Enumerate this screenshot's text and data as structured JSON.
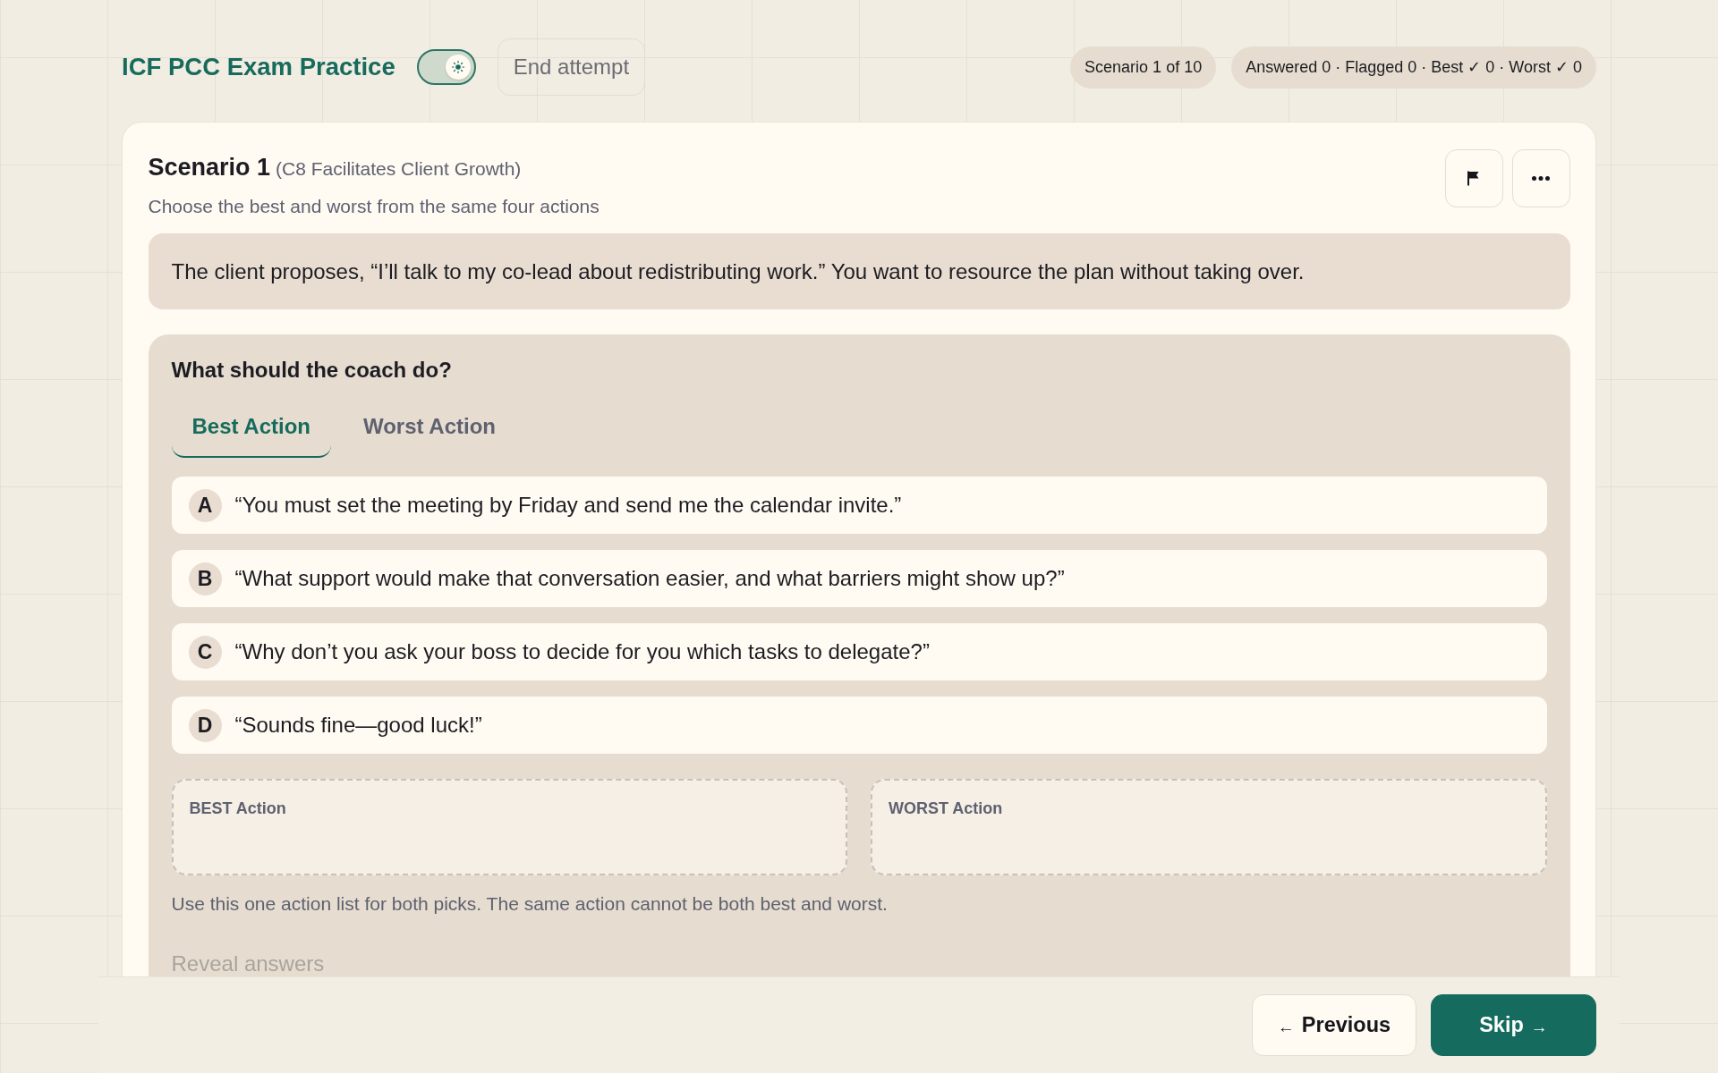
{
  "header": {
    "title": "ICF PCC Exam Practice",
    "theme_toggle": {
      "on": true
    },
    "end_button": "End attempt",
    "counter": "Scenario 1 of 10",
    "stats": "Answered 0 · Flagged 0 · Best ✓ 0 · Worst ✓ 0"
  },
  "scenario": {
    "title": "Scenario 1",
    "competency": "(C8 Facilitates Client Growth)",
    "instructions": "Choose the best and worst from the same four actions",
    "prompt": "The client proposes, “I’ll talk to my co-lead about redistributing work.” You want to resource the plan without taking over."
  },
  "question": {
    "heading": "What should the coach do?",
    "tabs": [
      {
        "label": "Best Action",
        "selected": true
      },
      {
        "label": "Worst Action",
        "selected": false
      }
    ],
    "options": [
      {
        "letter": "A",
        "text": "“You must set the meeting by Friday and send me the calendar invite.”",
        "selected": false
      },
      {
        "letter": "B",
        "text": "“What support would make that conversation easier, and what barriers might show up?”",
        "selected": false
      },
      {
        "letter": "C",
        "text": "“Why don’t you ask your boss to decide for you which tasks to delegate?”",
        "selected": false
      },
      {
        "letter": "D",
        "text": "“Sounds fine—good luck!”",
        "selected": false
      }
    ],
    "drop_zones": [
      {
        "label": "BEST Action"
      },
      {
        "label": "WORST Action"
      }
    ],
    "note": "Use this one action list for both picks. The same action cannot be both best and worst.",
    "reveal": {
      "label": "Reveal answers",
      "disabled": true
    }
  },
  "footer": {
    "buttons": [
      {
        "kind": "secondary",
        "lead": "←",
        "label": "Previous"
      },
      {
        "kind": "primary",
        "label": "Skip",
        "trail": "→"
      }
    ]
  }
}
